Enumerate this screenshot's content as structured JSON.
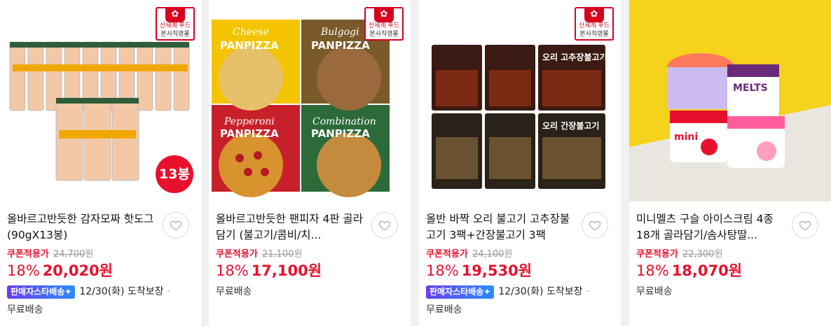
{
  "cards": [
    {
      "title": "올바르고반듯한 감자모짜 핫도그 (90gX13봉)",
      "badge": {
        "logo": "✿",
        "brand": "신세계 푸드",
        "sub": "본사직영몰"
      },
      "count_badge": "13봉",
      "coupon_label": "쿠폰적용가",
      "original_price": "24,700",
      "currency": "원",
      "discount": "18%",
      "price": "20,020원",
      "star_delivery": "판매자스타배송✦",
      "arrival": "12/30(화) 도착보장",
      "dot": "·",
      "shipping": "무료배송",
      "package_labels": [
        "올바르고 반듯한",
        "감자모짜",
        "13봉"
      ]
    },
    {
      "title": "올바르고반듯한 팬피자 4판 골라담기 (불고기/콤비/치...",
      "badge": {
        "logo": "✿",
        "brand": "신세계 푸드",
        "sub": "본사직영몰"
      },
      "coupon_label": "쿠폰적용가",
      "original_price": "21,100",
      "currency": "원",
      "discount": "18%",
      "price": "17,100원",
      "shipping": "무료배송",
      "package_labels": [
        "Cheese",
        "PANPIZZA",
        "Bulgogi",
        "PANPIZZA",
        "Pepperoni",
        "PANPIZZA",
        "Combination",
        "PANPIZZA"
      ]
    },
    {
      "title": "올반 바짝 오리 불고기 고추장불고기 3팩+간장불고기 3팩",
      "badge": {
        "logo": "✿",
        "brand": "신세계 푸드",
        "sub": "본사직영몰"
      },
      "coupon_label": "쿠폰적용가",
      "original_price": "24,100",
      "currency": "원",
      "discount": "18%",
      "price": "19,530원",
      "star_delivery": "판매자스타배송✦",
      "arrival": "12/30(화) 도착보장",
      "dot": "·",
      "shipping": "무료배송",
      "package_labels": [
        "오리 고추장불고기",
        "오리 간장불고기"
      ]
    },
    {
      "title": "미니멜츠 구슬 아이스크림 4종 18개 골라담기/솜사탕딸...",
      "coupon_label": "쿠폰적용가",
      "original_price": "22,300",
      "currency": "원",
      "discount": "18%",
      "price": "18,070원",
      "shipping": "무료배송",
      "package_labels": [
        "mini",
        "MELTS"
      ]
    }
  ],
  "colors": {
    "accent": "#e8112d",
    "brand": "#d7001f",
    "ice_bg": "#f5d21c"
  }
}
